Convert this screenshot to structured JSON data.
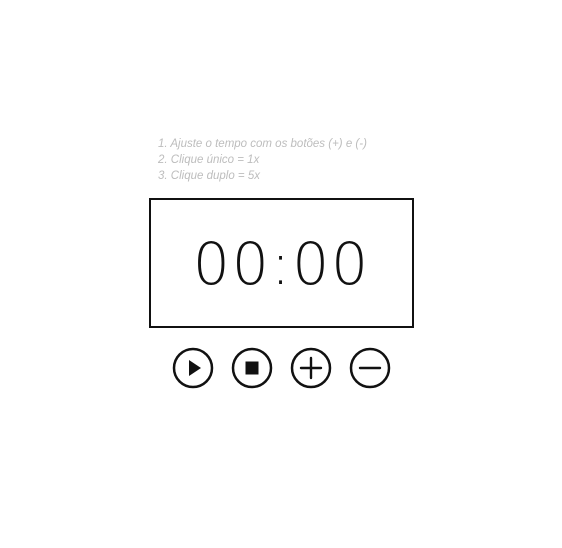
{
  "instructions": [
    "1. Ajuste o tempo com os botões (+) e (-)",
    "2. Clique único = 1x",
    "3. Clique duplo = 5x"
  ],
  "timer": {
    "display": "00:00"
  },
  "controls": [
    {
      "name": "play-button",
      "icon": "play-icon"
    },
    {
      "name": "stop-button",
      "icon": "stop-icon"
    },
    {
      "name": "increment-button",
      "icon": "plus-icon"
    },
    {
      "name": "decrement-button",
      "icon": "minus-icon"
    }
  ],
  "colors": {
    "ink": "#111111",
    "instruction_text": "#bdbdbd",
    "background": "#ffffff"
  }
}
